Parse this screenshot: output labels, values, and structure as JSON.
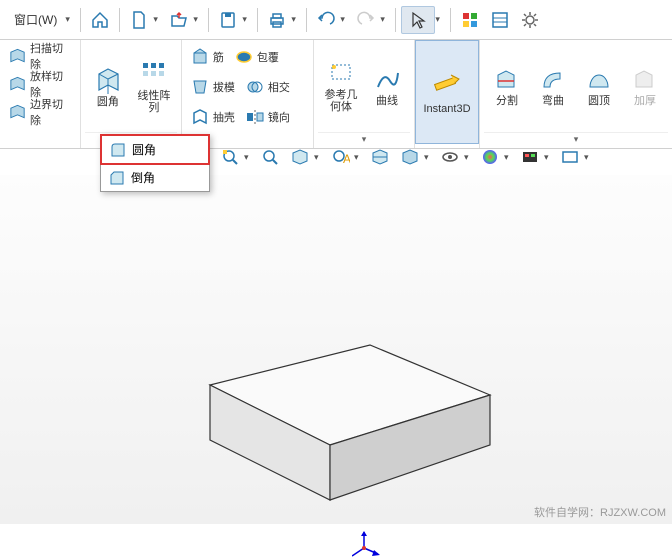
{
  "menu": {
    "window": "窗口(W)"
  },
  "topIcons": [
    "home",
    "new",
    "open",
    "save",
    "print",
    "undo",
    "redo",
    "select",
    "color",
    "panel",
    "settings"
  ],
  "ribbon": {
    "group1": [
      {
        "icon": "sweep-cut",
        "label": "扫描切除"
      },
      {
        "icon": "loft-cut",
        "label": "放样切除"
      },
      {
        "icon": "boundary-cut",
        "label": "边界切除"
      }
    ],
    "group2_big": {
      "icon": "fillet",
      "label": "圆角"
    },
    "group2_big2": {
      "icon": "linear-pattern",
      "label": "线性阵列"
    },
    "group3": [
      [
        {
          "icon": "rib",
          "label": "筋"
        },
        {
          "icon": "wrap",
          "label": "包覆"
        }
      ],
      [
        {
          "icon": "draft",
          "label": "拔模"
        },
        {
          "icon": "intersect",
          "label": "相交"
        }
      ],
      [
        {
          "icon": "shell",
          "label": "抽壳"
        },
        {
          "icon": "mirror",
          "label": "镜向"
        }
      ]
    ],
    "group4": [
      {
        "icon": "ref-geom",
        "label": "参考几何体"
      },
      {
        "icon": "curves",
        "label": "曲线"
      }
    ],
    "instant3d": {
      "label": "Instant3D"
    },
    "group5": [
      {
        "icon": "split",
        "label": "分割"
      },
      {
        "icon": "bend",
        "label": "弯曲"
      },
      {
        "icon": "dome",
        "label": "圆顶"
      },
      {
        "icon": "thicken",
        "label": "加厚",
        "disabled": true
      }
    ]
  },
  "popup": {
    "item1": "圆角",
    "item2": "倒角"
  },
  "watermark": "软件自学网：RJZXW.COM"
}
